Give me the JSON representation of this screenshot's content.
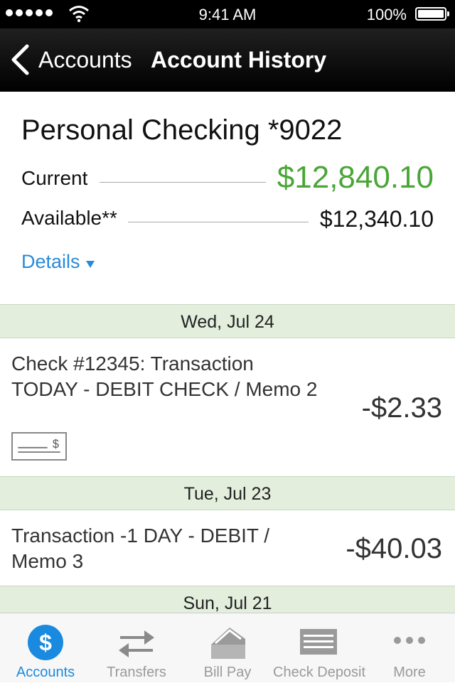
{
  "status": {
    "time": "9:41 AM",
    "battery": "100%"
  },
  "nav": {
    "back_label": "Accounts",
    "title": "Account History"
  },
  "account": {
    "name": "Personal Checking *9022",
    "current_label": "Current",
    "current_value": "$12,840.10",
    "available_label": "Available**",
    "available_value": "$12,340.10",
    "details_label": "Details"
  },
  "groups": [
    {
      "date": "Wed, Jul 24",
      "transactions": [
        {
          "desc": "Check #12345: Transaction TODAY - DEBIT CHECK / Memo 2",
          "amount": "-$2.33",
          "has_check_image": true
        }
      ]
    },
    {
      "date": "Tue, Jul 23",
      "transactions": [
        {
          "desc": "Transaction -1 DAY - DEBIT / Memo 3",
          "amount": "-$40.03"
        }
      ]
    },
    {
      "date": "Sun, Jul 21",
      "transactions": []
    }
  ],
  "tabs": [
    {
      "label": "Accounts",
      "icon": "dollar-icon",
      "active": true
    },
    {
      "label": "Transfers",
      "icon": "transfer-arrows-icon"
    },
    {
      "label": "Bill Pay",
      "icon": "bill-pay-icon"
    },
    {
      "label": "Check Deposit",
      "icon": "check-icon"
    },
    {
      "label": "More",
      "icon": "ellipsis-icon"
    }
  ],
  "colors": {
    "accent": "#1a8ae0",
    "positive": "#49a637",
    "date_header_bg": "#e3eedd"
  }
}
